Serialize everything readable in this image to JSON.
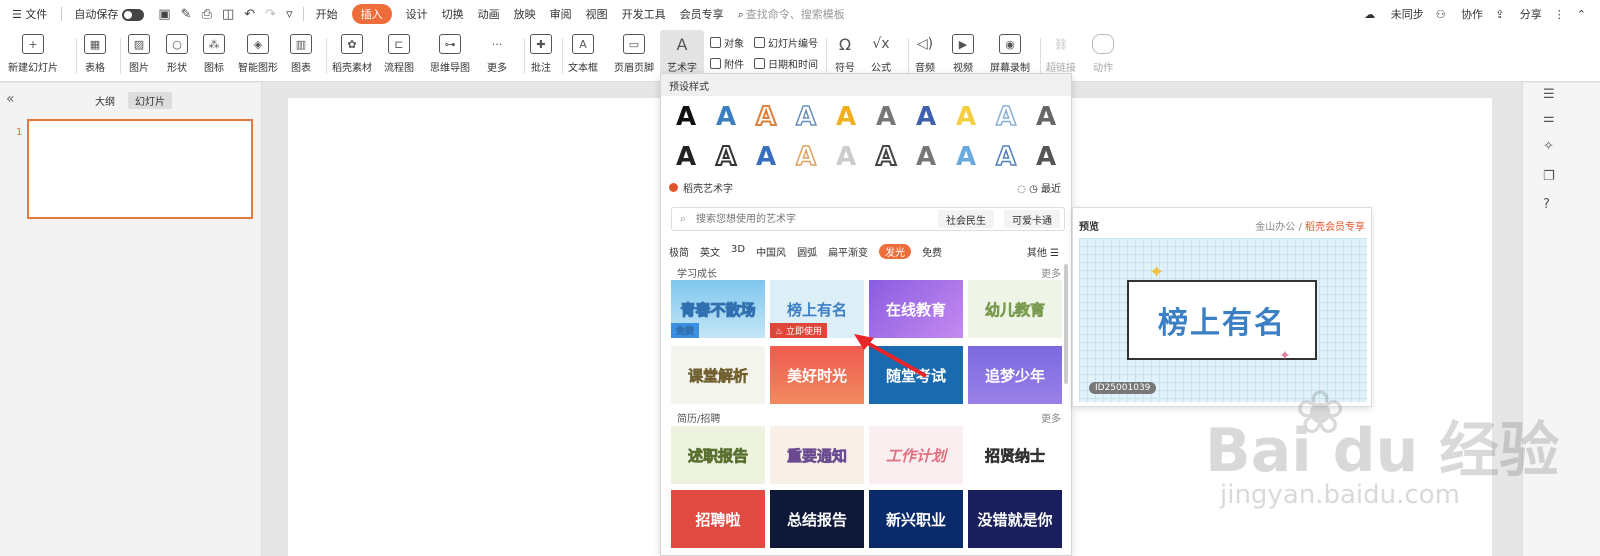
{
  "menubar": {
    "file": "文件",
    "autosave": "自动保存",
    "tabs": [
      "开始",
      "插入",
      "设计",
      "切换",
      "动画",
      "放映",
      "审阅",
      "视图",
      "开发工具",
      "会员专享"
    ],
    "active_tab": "插入",
    "search": "查找命令、搜索模板",
    "right": {
      "sync": "未同步",
      "collab": "协作",
      "share": "分享"
    }
  },
  "ribbon": {
    "new_slide": "新建幻灯片",
    "table": "表格",
    "picture": "图片",
    "shape": "形状",
    "icon": "图标",
    "smart": "智能图形",
    "chart": "图表",
    "daoke": "稻壳素材",
    "flow": "流程图",
    "mind": "思维导图",
    "more": "更多",
    "comment": "批注",
    "textbox": "文本框",
    "header": "页眉页脚",
    "wordart": "艺术字",
    "object": "对象",
    "attach": "附件",
    "slide_num": "幻灯片编号",
    "datetime": "日期和时间",
    "symbol": "符号",
    "formula": "公式",
    "audio": "音频",
    "video": "视频",
    "record": "屏幕录制",
    "hyperlink": "超链接",
    "action": "动作"
  },
  "left_panel": {
    "tab_outline": "大纲",
    "tab_slides": "幻灯片",
    "slide_number": "1"
  },
  "dropdown": {
    "preset_title": "预设样式",
    "preset_glyph": "A",
    "brand": "稻壳艺术字",
    "recent": "最近",
    "search_placeholder": "搜索您想使用的艺术字",
    "chip1": "社会民生",
    "chip2": "可爱卡通",
    "categories": [
      "极简",
      "英文",
      "3D",
      "中国风",
      "圆弧",
      "扁平渐变",
      "发光",
      "免费"
    ],
    "active_category": "发光",
    "other": "其他 ☰",
    "section1": "学习成长",
    "section2": "简历/招聘",
    "more": "更多",
    "tiles1": [
      "青春不散场",
      "榜上有名",
      "在线教育",
      "幼儿教育"
    ],
    "tiles2": [
      "课堂解析",
      "美好时光",
      "随堂考试",
      "追梦少年"
    ],
    "tiles3": [
      "述职报告",
      "重要通知",
      "工作计划",
      "招贤纳士"
    ],
    "tiles4": [
      "招聘啦",
      "总结报告",
      "新兴职业",
      "没错就是你"
    ],
    "badge_free": "免费",
    "badge_use": "立即使用"
  },
  "preview": {
    "title": "预览",
    "source": "金山办公",
    "source_member": "稻壳会员专享",
    "art_text": "榜上有名",
    "id": "ID25001039"
  },
  "watermark": {
    "main": "Bai du 经验",
    "sub": "jingyan.baidu.com"
  }
}
